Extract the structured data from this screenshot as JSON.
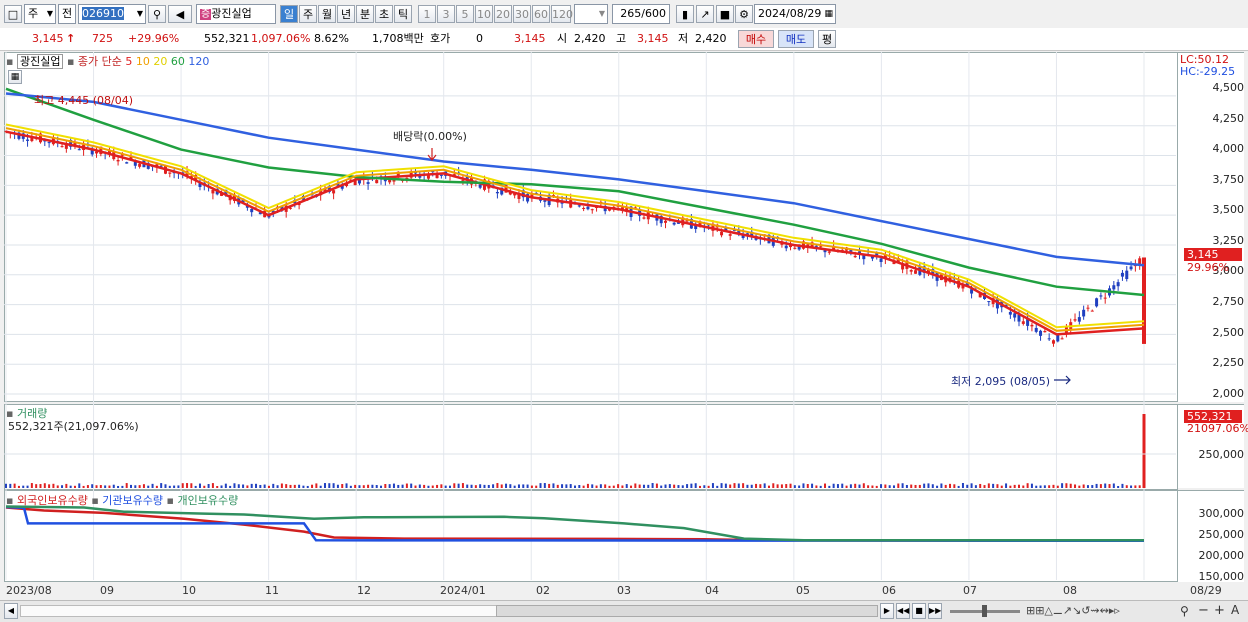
{
  "toolbar": {
    "period_type": "주",
    "prev_label": "전",
    "stock_code": "026910",
    "stock_name": "광진실업",
    "periods": [
      "일",
      "주",
      "월",
      "년",
      "분",
      "초",
      "틱"
    ],
    "intervals": [
      "1",
      "3",
      "5",
      "10",
      "20",
      "30",
      "60",
      "120"
    ],
    "count_current": "265",
    "count_total": "/600",
    "date": "2024/08/29"
  },
  "quote": {
    "price": "3,145",
    "arrow": "↑",
    "change": "725",
    "change_pct": "+29.96%",
    "volume": "552,321",
    "volume_pct": "1,097.06%",
    "turnover_pct": "8.62%",
    "amount": "1,708백만",
    "hoga_label": "호가",
    "hoga_value": "0",
    "last_price": "3,145",
    "open_label": "시",
    "open": "2,420",
    "high_label": "고",
    "high": "3,145",
    "low_label": "저",
    "low": "2,420",
    "buy_label": "매수",
    "sell_label": "매도",
    "eval_label": "평"
  },
  "price_panel": {
    "legend_name": "광진실업",
    "legend_ma": "종가 단순",
    "ma_periods": [
      "5",
      "10",
      "20",
      "60",
      "120"
    ],
    "ma_colors": [
      "#e02020",
      "#f0a000",
      "#f0e000",
      "#20a040",
      "#3060e0"
    ],
    "lc": "LC:50.12",
    "hc": "HC:-29.25",
    "yticks": [
      "4,500",
      "4,250",
      "4,000",
      "3,750",
      "3,500",
      "3,250",
      "3,000",
      "2,750",
      "2,500",
      "2,250",
      "2,000"
    ],
    "current_price_label": "3,145",
    "current_pct_label": "29.96%",
    "high_annotation": "최고 4,445 (08/04)",
    "low_annotation": "최저 2,095 (08/05)",
    "dividend_annotation": "배당락(0.00%)"
  },
  "volume_panel": {
    "legend": "거래량",
    "value_text": "552,321주(21,097.06%)",
    "badge_value": "552,321",
    "badge_pct": "21097.06%",
    "ytick": "250,000"
  },
  "holdings_panel": {
    "legends": [
      "외국인보유수량",
      "기관보유수량",
      "개인보유수량"
    ],
    "legend_colors": [
      "#d02020",
      "#2050e0",
      "#309060"
    ],
    "yticks": [
      "300,000",
      "250,000",
      "200,000",
      "150,000"
    ]
  },
  "x_axis": {
    "labels": [
      "2023/08",
      "09",
      "10",
      "11",
      "12",
      "2024/01",
      "02",
      "03",
      "04",
      "05",
      "06",
      "07",
      "08"
    ],
    "end_label": "08/29"
  },
  "chart_data": {
    "type": "candlestick",
    "title": "광진실업",
    "x": [
      "2023/08",
      "09",
      "10",
      "11",
      "12",
      "2024/01",
      "02",
      "03",
      "04",
      "05",
      "06",
      "07",
      "08",
      "08/29"
    ],
    "ylim": [
      2000,
      4600
    ],
    "close_approx": [
      4200,
      4050,
      3850,
      3500,
      3800,
      3850,
      3650,
      3550,
      3400,
      3250,
      3150,
      2900,
      2450,
      3145
    ],
    "series": [
      {
        "name": "5",
        "values": [
          4200,
          4050,
          3850,
          3500,
          3800,
          3850,
          3650,
          3550,
          3400,
          3250,
          3150,
          2900,
          2500,
          2550
        ]
      },
      {
        "name": "60",
        "values": [
          4560,
          4300,
          4050,
          3900,
          3820,
          3780,
          3760,
          3700,
          3560,
          3420,
          3260,
          3060,
          2900,
          2830
        ]
      },
      {
        "name": "120",
        "values": [
          4520,
          4450,
          4300,
          4150,
          4050,
          3950,
          3880,
          3800,
          3700,
          3600,
          3450,
          3300,
          3150,
          3080
        ]
      }
    ],
    "annotations": {
      "high": "최고 4,445 (08/04)",
      "low": "최저 2,095 (08/05)",
      "dividend": "배당락(0.00%)"
    }
  }
}
